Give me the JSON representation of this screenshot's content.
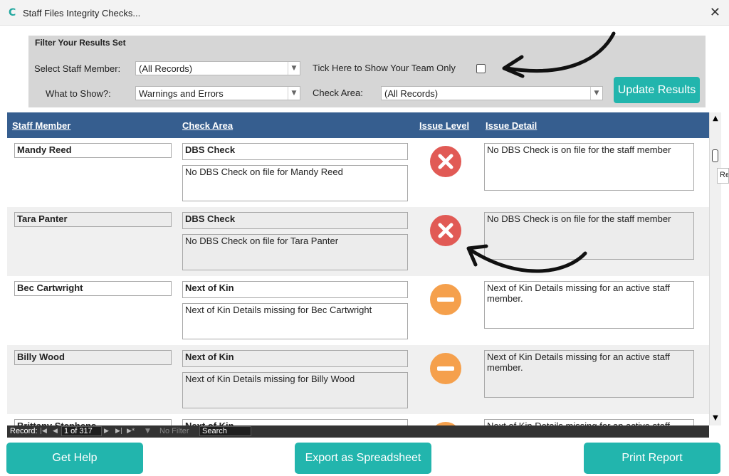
{
  "window": {
    "title": "Staff Files Integrity Checks...",
    "close_glyph": "✕",
    "app_icon": "C"
  },
  "filter": {
    "title": "Filter Your Results Set",
    "staff_label": "Select Staff Member:",
    "staff_value": "(All Records)",
    "team_label": "Tick Here to Show Your Team Only",
    "team_checked": false,
    "show_label": "What to Show?:",
    "show_value": "Warnings and Errors",
    "area_label": "Check Area:",
    "area_value": "(All Records)",
    "update_button": "Update Results"
  },
  "table": {
    "headers": [
      "Staff Member",
      "Check Area",
      "Issue Level",
      "Issue Detail"
    ],
    "rows": [
      {
        "staff": "Mandy Reed",
        "area": "DBS Check",
        "area_detail": "No DBS Check on file for Mandy Reed",
        "level": "error",
        "detail": "No DBS Check is on file for the staff member"
      },
      {
        "staff": "Tara Panter",
        "area": "DBS Check",
        "area_detail": "No DBS Check on file for Tara Panter",
        "level": "error",
        "detail": "No DBS Check is on file for the staff member"
      },
      {
        "staff": "Bec Cartwright",
        "area": "Next of Kin",
        "area_detail": "Next of Kin Details missing for Bec Cartwright",
        "level": "warning",
        "detail": "Next of Kin Details missing for an active staff member."
      },
      {
        "staff": "Billy Wood",
        "area": "Next of Kin",
        "area_detail": "Next of Kin Details missing for Billy Wood",
        "level": "warning",
        "detail": "Next of Kin Details missing for an active staff member."
      },
      {
        "staff": "Brittany Stephens",
        "area": "Next of Kin",
        "area_detail": "",
        "level": "warning",
        "detail": "Next of Kin Details missing for an active staff"
      }
    ]
  },
  "side_stub": "Re",
  "nav": {
    "record_label": "Record:",
    "position": "1 of 317",
    "filter_label": "No Filter",
    "search_label": "Search"
  },
  "buttons": {
    "help": "Get Help",
    "export": "Export as Spreadsheet",
    "print": "Print Report"
  },
  "colors": {
    "accent": "#22b5ad",
    "header": "#365e8f",
    "error": "#e15a55",
    "warning": "#f5a04c"
  }
}
